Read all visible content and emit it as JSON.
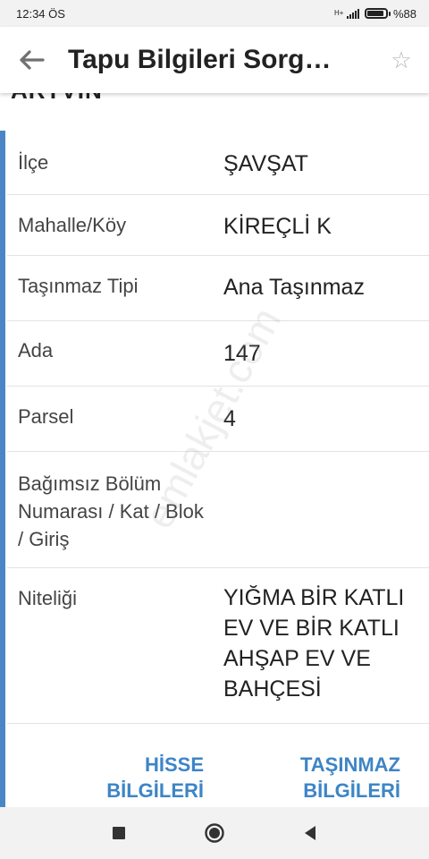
{
  "status_bar": {
    "time": "12:34 ÖS",
    "network": "H+",
    "battery_text": "%88",
    "battery_level": 0.88
  },
  "app_bar": {
    "title": "Tapu Bilgileri Sorg…",
    "back_icon": "arrow-left-icon",
    "star_icon": "star-outline-icon"
  },
  "section": {
    "heading": "ARTVİN"
  },
  "rows": [
    {
      "label": "İlçe",
      "value": "ŞAVŞAT"
    },
    {
      "label": "Mahalle/Köy",
      "value": "KİREÇLİ K"
    },
    {
      "label": "Taşınmaz Tipi",
      "value": "Ana Taşınmaz"
    },
    {
      "label": "Ada",
      "value": "147"
    },
    {
      "label": "Parsel",
      "value": "4"
    },
    {
      "label": "Bağımsız Bölüm Numarası / Kat / Blok / Giriş",
      "value": ""
    },
    {
      "label": "Niteliği",
      "value": "YIĞMA BİR KATLI EV VE BİR KATLI AHŞAP EV VE BAHÇESİ"
    }
  ],
  "actions": {
    "share_info": "HİSSE BİLGİLERİ",
    "property_info": "TAŞINMAZ BİLGİLERİ"
  },
  "watermark": "emlakjet.com",
  "colors": {
    "accent": "#4a86c5",
    "link": "#3d85c6",
    "background": "#f4f4f4",
    "card": "#ffffff"
  }
}
